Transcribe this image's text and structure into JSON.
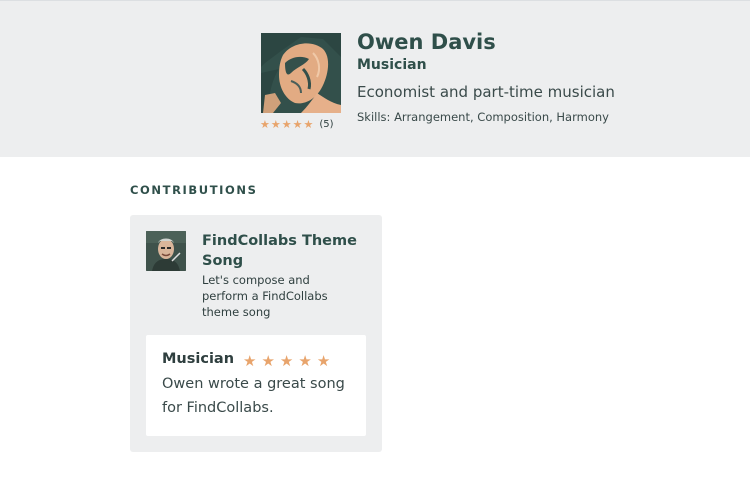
{
  "profile": {
    "name": "Owen Davis",
    "role": "Musician",
    "tagline": "Economist and part-time musician",
    "skills": "Skills: Arrangement, Composition, Harmony",
    "rating": {
      "stars": 5,
      "count_label": "(5)"
    },
    "avatar_icon": "profile-photo"
  },
  "contributions": {
    "title": "CONTRIBUTIONS",
    "items": [
      {
        "project_title": "FindCollabs Theme Song",
        "project_description": "Let's compose and perform a FindCollabs theme song",
        "thumbnail_icon": "project-photo",
        "review": {
          "role": "Musician",
          "stars": 5,
          "text": "Owen wrote a great song for FindCollabs."
        }
      }
    ]
  },
  "colors": {
    "star": "#e8a46c",
    "header_bg": "#edeeef",
    "card_bg": "#edeeef",
    "heading": "#2f4f4a"
  }
}
